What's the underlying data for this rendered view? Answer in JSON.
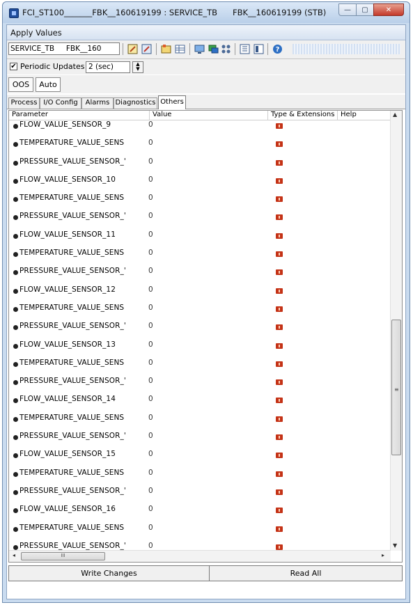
{
  "window": {
    "title": "FCI_ST100_______FBK__160619199 : SERVICE_TB      FBK__160619199 (STB)",
    "minimize_glyph": "—",
    "maximize_glyph": "▢",
    "close_glyph": "✕"
  },
  "menubar": {
    "label": "Apply Values"
  },
  "toolbar": {
    "block_selector": "SERVICE_TB     FBK__160",
    "icons": [
      "edit-block-icon",
      "edit-all-icon",
      "compare-icon",
      "table-icon",
      "monitor-icon",
      "network-icon",
      "trend-icon",
      "grid-view-icon",
      "list-view-icon",
      "help-icon"
    ]
  },
  "periodic": {
    "checked": true,
    "check_glyph": "✔",
    "label": "Periodic Updates",
    "interval": "2 (sec)"
  },
  "modes": {
    "oos": "OOS",
    "auto": "Auto"
  },
  "tabs": [
    {
      "label": "Process",
      "active": false
    },
    {
      "label": "I/O Config",
      "active": false
    },
    {
      "label": "Alarms",
      "active": false
    },
    {
      "label": "Diagnostics",
      "active": false
    },
    {
      "label": "Others",
      "active": true
    }
  ],
  "grid": {
    "columns": {
      "parameter": "Parameter",
      "value": "Value",
      "type": "Type & Extensions",
      "help": "Help"
    },
    "rows": [
      {
        "name": "FLOW_VALUE_SENSOR_9",
        "value": "0"
      },
      {
        "name": "TEMPERATURE_VALUE_SENS",
        "value": "0"
      },
      {
        "name": "PRESSURE_VALUE_SENSOR_'",
        "value": "0"
      },
      {
        "name": "FLOW_VALUE_SENSOR_10",
        "value": "0"
      },
      {
        "name": "TEMPERATURE_VALUE_SENS",
        "value": "0"
      },
      {
        "name": "PRESSURE_VALUE_SENSOR_'",
        "value": "0"
      },
      {
        "name": "FLOW_VALUE_SENSOR_11",
        "value": "0"
      },
      {
        "name": "TEMPERATURE_VALUE_SENS",
        "value": "0"
      },
      {
        "name": "PRESSURE_VALUE_SENSOR_'",
        "value": "0"
      },
      {
        "name": "FLOW_VALUE_SENSOR_12",
        "value": "0"
      },
      {
        "name": "TEMPERATURE_VALUE_SENS",
        "value": "0"
      },
      {
        "name": "PRESSURE_VALUE_SENSOR_'",
        "value": "0"
      },
      {
        "name": "FLOW_VALUE_SENSOR_13",
        "value": "0"
      },
      {
        "name": "TEMPERATURE_VALUE_SENS",
        "value": "0"
      },
      {
        "name": "PRESSURE_VALUE_SENSOR_'",
        "value": "0"
      },
      {
        "name": "FLOW_VALUE_SENSOR_14",
        "value": "0"
      },
      {
        "name": "TEMPERATURE_VALUE_SENS",
        "value": "0"
      },
      {
        "name": "PRESSURE_VALUE_SENSOR_'",
        "value": "0"
      },
      {
        "name": "FLOW_VALUE_SENSOR_15",
        "value": "0"
      },
      {
        "name": "TEMPERATURE_VALUE_SENS",
        "value": "0"
      },
      {
        "name": "PRESSURE_VALUE_SENSOR_'",
        "value": "0"
      },
      {
        "name": "FLOW_VALUE_SENSOR_16",
        "value": "0"
      },
      {
        "name": "TEMPERATURE_VALUE_SENS",
        "value": "0"
      },
      {
        "name": "PRESSURE_VALUE_SENSOR_'",
        "value": "0"
      }
    ]
  },
  "scrollbars": {
    "up_glyph": "▲",
    "down_glyph": "▼",
    "left_glyph": "◂",
    "right_glyph": "▸",
    "vgrip": "≡",
    "hgrip": "III"
  },
  "buttons": {
    "write": "Write Changes",
    "read": "Read All"
  },
  "colors": {
    "title_bar": "#c9dbef",
    "type_flag": "#c43216"
  }
}
